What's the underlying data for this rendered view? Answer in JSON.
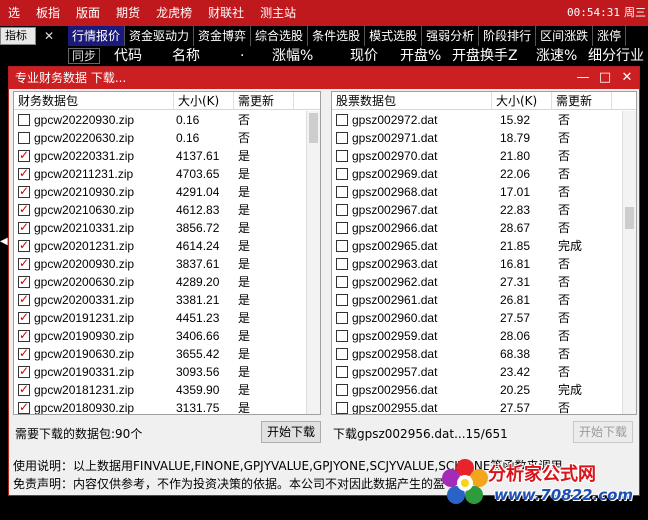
{
  "topmenu": {
    "items": [
      "选",
      "板指",
      "版面",
      "期货",
      "龙虎榜",
      "财联社",
      "测主站"
    ],
    "clock": "00:54:31",
    "weekday": "周三"
  },
  "tabstrip": {
    "zhibiao": "指标",
    "close": "✕",
    "tabs": [
      "行情报价",
      "资金驱动力",
      "资金博弈",
      "综合选股",
      "条件选股",
      "模式选股",
      "强弱分析",
      "阶段排行",
      "区间涨跌",
      "涨停"
    ]
  },
  "colhdr": {
    "tongbu": "同步",
    "cols": [
      "代码",
      "名称",
      "·",
      "涨幅%",
      "现价",
      "开盘%",
      "开盘换手Z",
      "涨速%",
      "细分行业"
    ]
  },
  "dialog": {
    "title": "专业财务数据 下载...",
    "buttons": {
      "minimize": "—",
      "maximize": "□",
      "close": "✕"
    },
    "left": {
      "headers": {
        "name": "财务数据包",
        "size": "大小(K)",
        "need": "需更新"
      },
      "rows": [
        {
          "name": "gpcw20220930.zip",
          "size": "0.16",
          "need": "否",
          "checked": false
        },
        {
          "name": "gpcw20220630.zip",
          "size": "0.16",
          "need": "否",
          "checked": false
        },
        {
          "name": "gpcw20220331.zip",
          "size": "4137.61",
          "need": "是",
          "checked": true
        },
        {
          "name": "gpcw20211231.zip",
          "size": "4703.65",
          "need": "是",
          "checked": true
        },
        {
          "name": "gpcw20210930.zip",
          "size": "4291.04",
          "need": "是",
          "checked": true
        },
        {
          "name": "gpcw20210630.zip",
          "size": "4612.83",
          "need": "是",
          "checked": true
        },
        {
          "name": "gpcw20210331.zip",
          "size": "3856.72",
          "need": "是",
          "checked": true
        },
        {
          "name": "gpcw20201231.zip",
          "size": "4614.24",
          "need": "是",
          "checked": true
        },
        {
          "name": "gpcw20200930.zip",
          "size": "3837.61",
          "need": "是",
          "checked": true
        },
        {
          "name": "gpcw20200630.zip",
          "size": "4289.20",
          "need": "是",
          "checked": true
        },
        {
          "name": "gpcw20200331.zip",
          "size": "3381.21",
          "need": "是",
          "checked": true
        },
        {
          "name": "gpcw20191231.zip",
          "size": "4451.23",
          "need": "是",
          "checked": true
        },
        {
          "name": "gpcw20190930.zip",
          "size": "3406.66",
          "need": "是",
          "checked": true
        },
        {
          "name": "gpcw20190630.zip",
          "size": "3655.42",
          "need": "是",
          "checked": true
        },
        {
          "name": "gpcw20190331.zip",
          "size": "3093.56",
          "need": "是",
          "checked": true
        },
        {
          "name": "gpcw20181231.zip",
          "size": "4359.90",
          "need": "是",
          "checked": true
        },
        {
          "name": "gpcw20180930.zip",
          "size": "3131.75",
          "need": "是",
          "checked": true
        }
      ]
    },
    "right": {
      "headers": {
        "name": "股票数据包",
        "size": "大小(K)",
        "need": "需更新"
      },
      "rows": [
        {
          "name": "gpsz002972.dat",
          "size": "15.92",
          "need": "否"
        },
        {
          "name": "gpsz002971.dat",
          "size": "18.79",
          "need": "否"
        },
        {
          "name": "gpsz002970.dat",
          "size": "21.80",
          "need": "否"
        },
        {
          "name": "gpsz002969.dat",
          "size": "22.06",
          "need": "否"
        },
        {
          "name": "gpsz002968.dat",
          "size": "17.01",
          "need": "否"
        },
        {
          "name": "gpsz002967.dat",
          "size": "22.83",
          "need": "否"
        },
        {
          "name": "gpsz002966.dat",
          "size": "28.67",
          "need": "否"
        },
        {
          "name": "gpsz002965.dat",
          "size": "21.85",
          "need": "完成"
        },
        {
          "name": "gpsz002963.dat",
          "size": "16.81",
          "need": "否"
        },
        {
          "name": "gpsz002962.dat",
          "size": "27.31",
          "need": "否"
        },
        {
          "name": "gpsz002961.dat",
          "size": "26.81",
          "need": "否"
        },
        {
          "name": "gpsz002960.dat",
          "size": "27.57",
          "need": "否"
        },
        {
          "name": "gpsz002959.dat",
          "size": "28.06",
          "need": "否"
        },
        {
          "name": "gpsz002958.dat",
          "size": "68.38",
          "need": "否"
        },
        {
          "name": "gpsz002957.dat",
          "size": "23.42",
          "need": "否"
        },
        {
          "name": "gpsz002956.dat",
          "size": "20.25",
          "need": "完成"
        },
        {
          "name": "gpsz002955.dat",
          "size": "27.57",
          "need": "否"
        }
      ]
    },
    "status_left": "需要下载的数据包:90个",
    "status_right": "下载gpsz002956.dat...15/651",
    "btn_start_left": "开始下载",
    "btn_start_right": "开始下载",
    "note1": "使用说明：以上数据用FINVALUE,FINONE,GPJYVALUE,GPJYONE,SCJYVALUE,SCJYONE等函数来调用",
    "note2": "免责声明：内容仅供参考，不作为投资决策的依据。本公司不对因此数据产生的盈"
  },
  "logo": {
    "text1": "分析家公式网",
    "text2": "www.70822.com"
  },
  "colors": {
    "menu_red": "#c0191d",
    "dialog_title_red": "#cc1f21",
    "active_tab": "#1a1a7a",
    "check_red": "#cc0000"
  }
}
